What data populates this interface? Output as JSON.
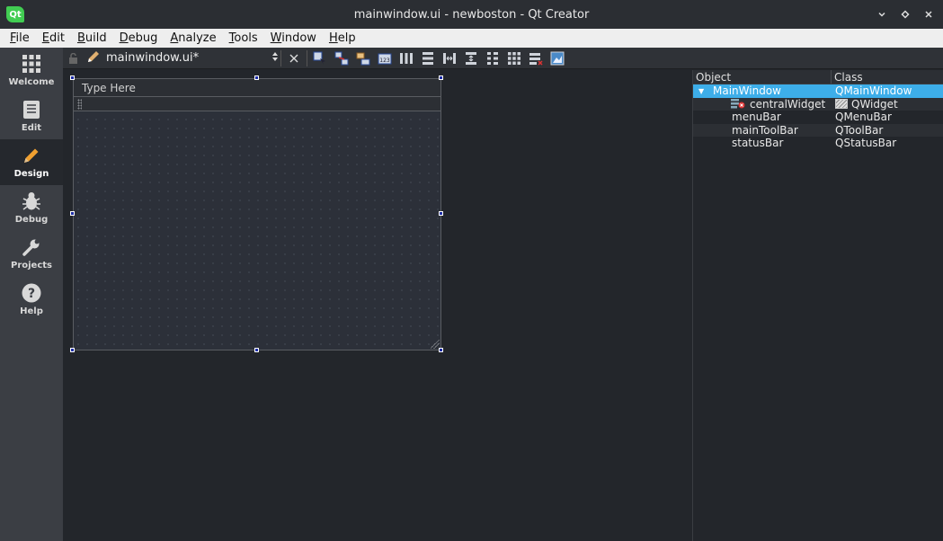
{
  "window": {
    "title": "mainwindow.ui - newboston - Qt Creator",
    "logo_text": "Qt"
  },
  "menu": [
    {
      "label": "File",
      "mnemonic": "F",
      "rest": "ile"
    },
    {
      "label": "Edit",
      "mnemonic": "E",
      "rest": "dit"
    },
    {
      "label": "Build",
      "mnemonic": "B",
      "rest": "uild"
    },
    {
      "label": "Debug",
      "mnemonic": "D",
      "rest": "ebug"
    },
    {
      "label": "Analyze",
      "mnemonic": "A",
      "rest": "nalyze"
    },
    {
      "label": "Tools",
      "mnemonic": "T",
      "rest": "ools"
    },
    {
      "label": "Window",
      "mnemonic": "W",
      "rest": "indow"
    },
    {
      "label": "Help",
      "mnemonic": "H",
      "rest": "elp"
    }
  ],
  "modes": [
    {
      "label": "Welcome",
      "icon": "grid-icon"
    },
    {
      "label": "Edit",
      "icon": "document-icon"
    },
    {
      "label": "Design",
      "icon": "pencil-icon",
      "active": true
    },
    {
      "label": "Debug",
      "icon": "bug-icon"
    },
    {
      "label": "Projects",
      "icon": "wrench-icon"
    },
    {
      "label": "Help",
      "icon": "question-icon"
    }
  ],
  "editor": {
    "file_name": "mainwindow.ui*"
  },
  "form": {
    "menubar_placeholder": "Type Here"
  },
  "object_inspector": {
    "columns": {
      "object": "Object",
      "class": "Class"
    },
    "rows": [
      {
        "object": "MainWindow",
        "class": "QMainWindow",
        "selected": true,
        "expanded": true
      },
      {
        "object": "centralWidget",
        "class": "QWidget"
      },
      {
        "object": "menuBar",
        "class": "QMenuBar"
      },
      {
        "object": "mainToolBar",
        "class": "QToolBar"
      },
      {
        "object": "statusBar",
        "class": "QStatusBar"
      }
    ]
  },
  "colors": {
    "selection": "#3daee9",
    "handle": "#1e2ea8",
    "qt_green": "#41cd52"
  }
}
